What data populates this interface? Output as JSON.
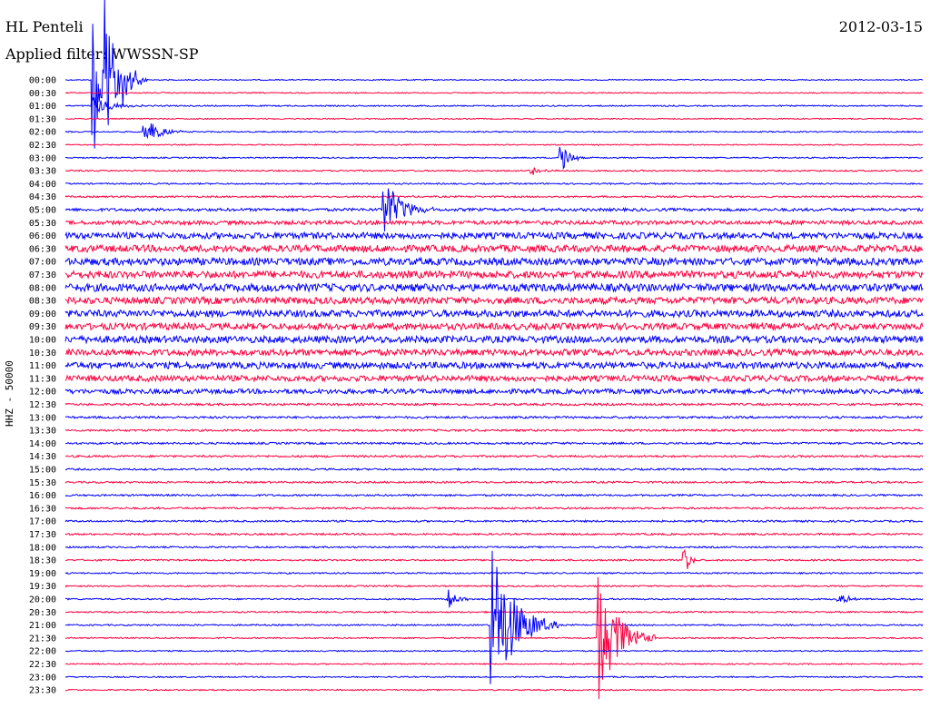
{
  "header": {
    "station": "HL Penteli",
    "filter": "Applied filter: WWSSN-SP",
    "date": "2012-03-15"
  },
  "channel_label": "HHZ - 50000",
  "colors": {
    "odd": "#0000ff",
    "even": "#ff0040"
  },
  "chart_data": {
    "type": "line",
    "title": "HL Penteli",
    "subtitle": "Applied filter: WWSSN-SP",
    "ylabel": "HHZ - 50000",
    "row_labels": [
      "00:00",
      "00:30",
      "01:00",
      "01:30",
      "02:00",
      "02:30",
      "03:00",
      "03:30",
      "04:00",
      "04:30",
      "05:00",
      "05:30",
      "06:00",
      "06:30",
      "07:00",
      "07:30",
      "08:00",
      "08:30",
      "09:00",
      "09:30",
      "10:00",
      "10:30",
      "11:00",
      "11:30",
      "12:00",
      "12:30",
      "13:00",
      "13:30",
      "14:00",
      "14:30",
      "15:00",
      "15:30",
      "16:00",
      "16:30",
      "17:00",
      "17:30",
      "18:00",
      "18:30",
      "19:00",
      "19:30",
      "20:00",
      "20:30",
      "21:00",
      "21:30",
      "22:00",
      "22:30",
      "23:00",
      "23:30"
    ],
    "noise_level": [
      0.6,
      0.6,
      0.7,
      0.6,
      0.7,
      0.6,
      0.7,
      0.8,
      0.8,
      0.9,
      1.6,
      2.2,
      3.5,
      3.8,
      4.0,
      4.0,
      4.2,
      3.8,
      3.8,
      3.6,
      3.8,
      3.5,
      3.6,
      3.2,
      2.6,
      1.2,
      1.2,
      1.1,
      1.1,
      1.1,
      1.0,
      1.0,
      1.0,
      1.0,
      1.0,
      1.0,
      0.9,
      0.9,
      0.8,
      0.8,
      0.8,
      0.8,
      0.8,
      0.7,
      0.7,
      0.7,
      0.7,
      0.7
    ],
    "events": [
      {
        "row": 0,
        "t": 0.03,
        "amp": 100,
        "dur": 0.06
      },
      {
        "row": 0,
        "t": 0.045,
        "amp": 95,
        "dur": 0.05
      },
      {
        "row": 2,
        "t": 0.03,
        "amp": 14,
        "dur": 0.06
      },
      {
        "row": 4,
        "t": 0.09,
        "amp": 20,
        "dur": 0.05
      },
      {
        "row": 6,
        "t": 0.575,
        "amp": 28,
        "dur": 0.03
      },
      {
        "row": 7,
        "t": 0.54,
        "amp": 8,
        "dur": 0.04
      },
      {
        "row": 10,
        "t": 0.37,
        "amp": 40,
        "dur": 0.06
      },
      {
        "row": 40,
        "t": 0.445,
        "amp": 14,
        "dur": 0.03
      },
      {
        "row": 42,
        "t": 0.495,
        "amp": 100,
        "dur": 0.08
      },
      {
        "row": 43,
        "t": 0.62,
        "amp": 80,
        "dur": 0.07
      },
      {
        "row": 37,
        "t": 0.72,
        "amp": 26,
        "dur": 0.02
      },
      {
        "row": 40,
        "t": 0.9,
        "amp": 8,
        "dur": 0.04
      }
    ]
  }
}
